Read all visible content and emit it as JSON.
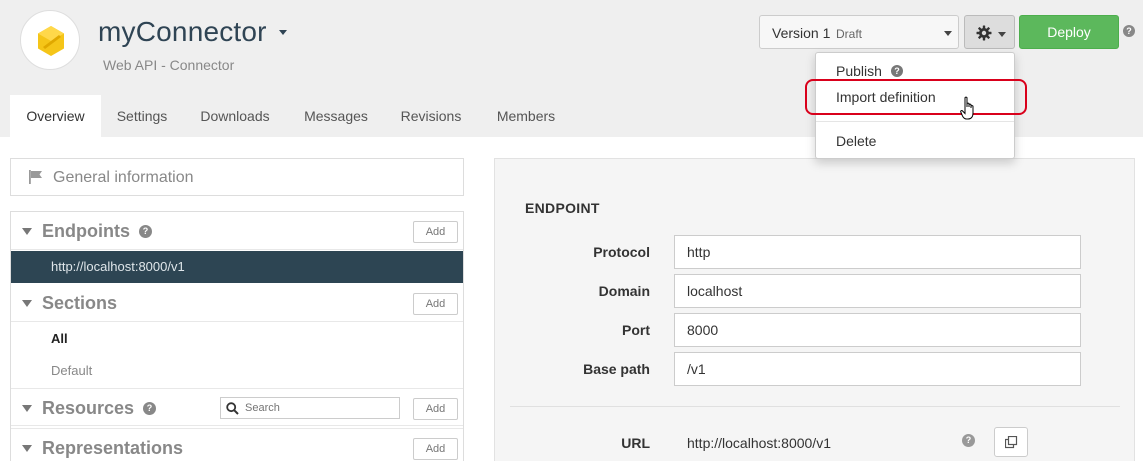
{
  "app": {
    "title": "myConnector",
    "subtitle": "Web API - Connector"
  },
  "version": {
    "label": "Version 1",
    "status": "Draft"
  },
  "toolbar": {
    "deploy_label": "Deploy"
  },
  "settings_menu": {
    "items": [
      {
        "label": "Publish"
      },
      {
        "label": "Import definition"
      },
      {
        "label": "Delete"
      }
    ]
  },
  "tabs": [
    {
      "label": "Overview",
      "active": true
    },
    {
      "label": "Settings"
    },
    {
      "label": "Downloads"
    },
    {
      "label": "Messages"
    },
    {
      "label": "Revisions"
    },
    {
      "label": "Members"
    }
  ],
  "sidebar": {
    "general_info": "General information",
    "add_label": "Add",
    "sections": [
      {
        "label": "Endpoints",
        "help": true,
        "items": [
          "http://localhost:8000/v1"
        ]
      },
      {
        "label": "Sections",
        "items": [
          "All",
          "Default"
        ]
      },
      {
        "label": "Resources",
        "help": true,
        "search_placeholder": "Search"
      },
      {
        "label": "Representations"
      }
    ]
  },
  "endpoint_form": {
    "heading": "ENDPOINT",
    "fields": [
      {
        "label": "Protocol",
        "value": "http"
      },
      {
        "label": "Domain",
        "value": "localhost"
      },
      {
        "label": "Port",
        "value": "8000"
      },
      {
        "label": "Base path",
        "value": "/v1"
      }
    ],
    "url_label": "URL",
    "url_value": "http://localhost:8000/v1"
  },
  "colors": {
    "accent_dark": "#2d4553",
    "deploy_green": "#5cb85c",
    "highlight_red": "#d9001b",
    "logo_yellow": "#f5c518"
  }
}
